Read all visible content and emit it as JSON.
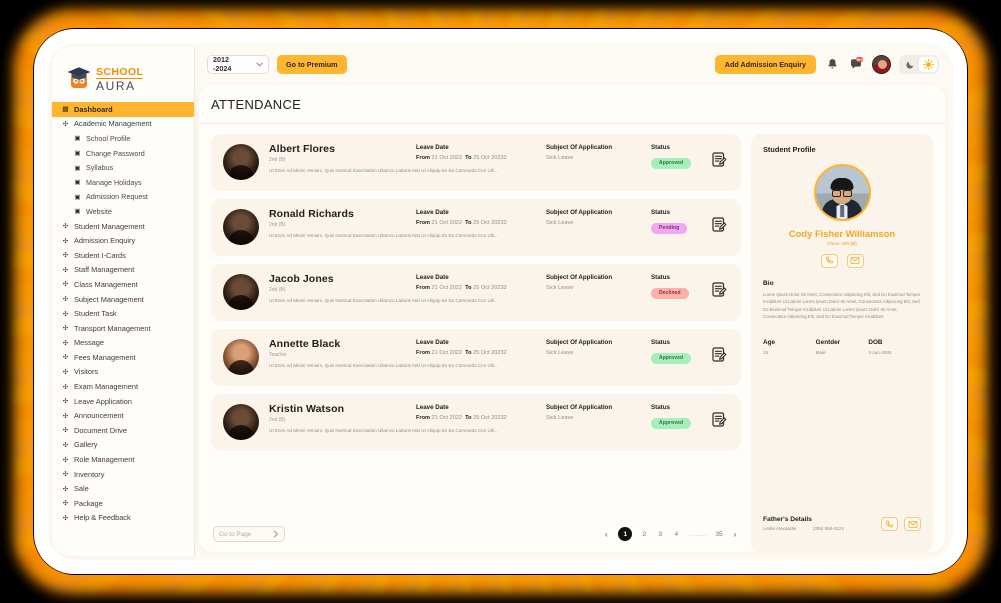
{
  "brand": {
    "school": "SCHOOL",
    "aura": "AURA"
  },
  "sidebar": {
    "items": [
      {
        "label": "Dashboard",
        "icon": "grid-icon",
        "active": true,
        "sub": false
      },
      {
        "label": "Academic Management",
        "icon": "asterisk-icon",
        "active": false,
        "sub": false
      },
      {
        "label": "School Profile",
        "icon": "building-icon",
        "active": false,
        "sub": true
      },
      {
        "label": "Change Password",
        "icon": "key-icon",
        "active": false,
        "sub": true
      },
      {
        "label": "Syllabus",
        "icon": "book-icon",
        "active": false,
        "sub": true
      },
      {
        "label": "Manage Holidays",
        "icon": "calendar-icon",
        "active": false,
        "sub": true
      },
      {
        "label": "Admission Request",
        "icon": "form-icon",
        "active": false,
        "sub": true
      },
      {
        "label": "Website",
        "icon": "globe-icon",
        "active": false,
        "sub": true
      },
      {
        "label": "Student Management",
        "icon": "asterisk-icon",
        "active": false,
        "sub": false
      },
      {
        "label": "Admission Enquiry",
        "icon": "asterisk-icon",
        "active": false,
        "sub": false
      },
      {
        "label": "Student I-Cards",
        "icon": "asterisk-icon",
        "active": false,
        "sub": false
      },
      {
        "label": "Staff Management",
        "icon": "asterisk-icon",
        "active": false,
        "sub": false
      },
      {
        "label": "Class Management",
        "icon": "asterisk-icon",
        "active": false,
        "sub": false
      },
      {
        "label": "Subject Management",
        "icon": "asterisk-icon",
        "active": false,
        "sub": false
      },
      {
        "label": "Student Task",
        "icon": "asterisk-icon",
        "active": false,
        "sub": false
      },
      {
        "label": "Transport Management",
        "icon": "asterisk-icon",
        "active": false,
        "sub": false
      },
      {
        "label": "Message",
        "icon": "asterisk-icon",
        "active": false,
        "sub": false
      },
      {
        "label": "Fees Management",
        "icon": "asterisk-icon",
        "active": false,
        "sub": false
      },
      {
        "label": "Visitors",
        "icon": "asterisk-icon",
        "active": false,
        "sub": false
      },
      {
        "label": "Exam Management",
        "icon": "asterisk-icon",
        "active": false,
        "sub": false
      },
      {
        "label": "Leave Application",
        "icon": "asterisk-icon",
        "active": false,
        "sub": false
      },
      {
        "label": "Announcement",
        "icon": "asterisk-icon",
        "active": false,
        "sub": false
      },
      {
        "label": "Document Drive",
        "icon": "asterisk-icon",
        "active": false,
        "sub": false
      },
      {
        "label": "Gallery",
        "icon": "asterisk-icon",
        "active": false,
        "sub": false
      },
      {
        "label": "Role Management",
        "icon": "asterisk-icon",
        "active": false,
        "sub": false
      },
      {
        "label": "Inventory",
        "icon": "asterisk-icon",
        "active": false,
        "sub": false
      },
      {
        "label": "Sale",
        "icon": "asterisk-icon",
        "active": false,
        "sub": false
      },
      {
        "label": "Package",
        "icon": "asterisk-icon",
        "active": false,
        "sub": false
      },
      {
        "label": "Help & Feedback",
        "icon": "asterisk-icon",
        "active": false,
        "sub": false
      }
    ]
  },
  "topbar": {
    "year_value": "2012 -2024",
    "premium_label": "Go to Premium",
    "enquiry_label": "Add Admission Enquiry",
    "notification_icon": "bell-icon",
    "message_icon": "chat-icon",
    "message_badge": "99+",
    "avatar_icon": "user-avatar",
    "dark_icon": "moon-icon",
    "light_icon": "sun-icon"
  },
  "page": {
    "title": "ATTENDANCE"
  },
  "table": {
    "headers": {
      "leave_date": "Leave Date",
      "subject": "Subject Of Application",
      "status": "Status",
      "from": "From",
      "to": "To"
    },
    "rows": [
      {
        "name": "Albert Flores",
        "class": "2nd (B)",
        "desc": "Ut Enim Ad Minim Veniam, Quis Nostrud Exercitation Ullamco Laboris Nisi Ut Aliquip Ex Ea Commodo Con Ulli...",
        "from": "21 Oct 2022",
        "to": "25 Oct 20232",
        "subject": "Sick Leave",
        "status": "Approved",
        "status_kind": "approved",
        "avatar": "dark"
      },
      {
        "name": "Ronald Richards",
        "class": "2nd (B)",
        "desc": "Ut Enim Ad Minim Veniam, Quis Nostrud Exercitation Ullamco Laboris Nisi Ut Aliquip Ex Ea Commodo Con Ulli...",
        "from": "21 Oct 2022",
        "to": "25 Oct 20232",
        "subject": "Sick Leave",
        "status": "Pending",
        "status_kind": "pending",
        "avatar": "dark"
      },
      {
        "name": "Jacob Jones",
        "class": "2nd (B)",
        "desc": "Ut Enim Ad Minim Veniam, Quis Nostrud Exercitation Ullamco Laboris Nisi Ut Aliquip Ex Ea Commodo Con Ulli...",
        "from": "21 Oct 2022",
        "to": "25 Oct 20232",
        "subject": "Sick Leave",
        "status": "Declined",
        "status_kind": "declined",
        "avatar": "dark"
      },
      {
        "name": "Annette Black",
        "class": "Teacher",
        "desc": "Ut Enim Ad Minim Veniam, Quis Nostrud Exercitation Ullamco Laboris Nisi Ut Aliquip Ex Ea Commodo Con Ulli...",
        "from": "21 Oct 2022",
        "to": "25 Oct 20232",
        "subject": "Sick Leave",
        "status": "Approved",
        "status_kind": "approved",
        "avatar": "light"
      },
      {
        "name": "Kristin Watson",
        "class": "2nd (B)",
        "desc": "Ut Enim Ad Minim Veniam, Quis Nostrud Exercitation Ullamco Laboris Nisi Ut Aliquip Ex Ea Commodo Con Ulli...",
        "from": "21 Oct 2022",
        "to": "25 Oct 20232",
        "subject": "Sick Leave",
        "status": "Approved",
        "status_kind": "approved",
        "avatar": "dark"
      }
    ]
  },
  "pagination": {
    "goto_label": "Go to Page",
    "prev_icon": "chevron-left-icon",
    "next_icon": "chevron-right-icon",
    "pages": [
      "1",
      "2",
      "3",
      "4",
      "........",
      "35"
    ],
    "current": "1"
  },
  "profile": {
    "title": "Student Profile",
    "name": "Cody Fisher Williamson",
    "class": "Class: 5th (B)",
    "call_icon": "phone-icon",
    "mail_icon": "envelope-icon",
    "bio_heading": "Bio",
    "bio": "Lorem Ipsum Dolor Sit Amet, Consectetur Adipiscing Elit, Sed Do Eiusmod Tempor Incididunt Ut Labore Lorem Ipsum Dolor Sit Amet, Consectetur Adipiscing Elit, Sed Do Eiusmod Tempor Incididunt Ut Labore Lorem Ipsum Dolor Sit Amet, Consectetur Adipiscing Elit, Sed Do Eiusmod Tempor Incididunt",
    "age_label": "Age",
    "age_value": "15",
    "gender_label": "Gentder",
    "gender_value": "Male",
    "dob_label": "DOB",
    "dob_value": "2-Jun-2008",
    "father_heading": "Father's Details",
    "father_name": "Leslie Alexander",
    "father_phone": "(308) 555-0121"
  },
  "colors": {
    "accent": "#ffb52e",
    "accent_text": "#f5a623",
    "approved": "#a8eeba",
    "pending": "#f0a9f0",
    "declined": "#fbb1ab",
    "panel": "#faf4ea",
    "surface": "#fffdfa"
  }
}
